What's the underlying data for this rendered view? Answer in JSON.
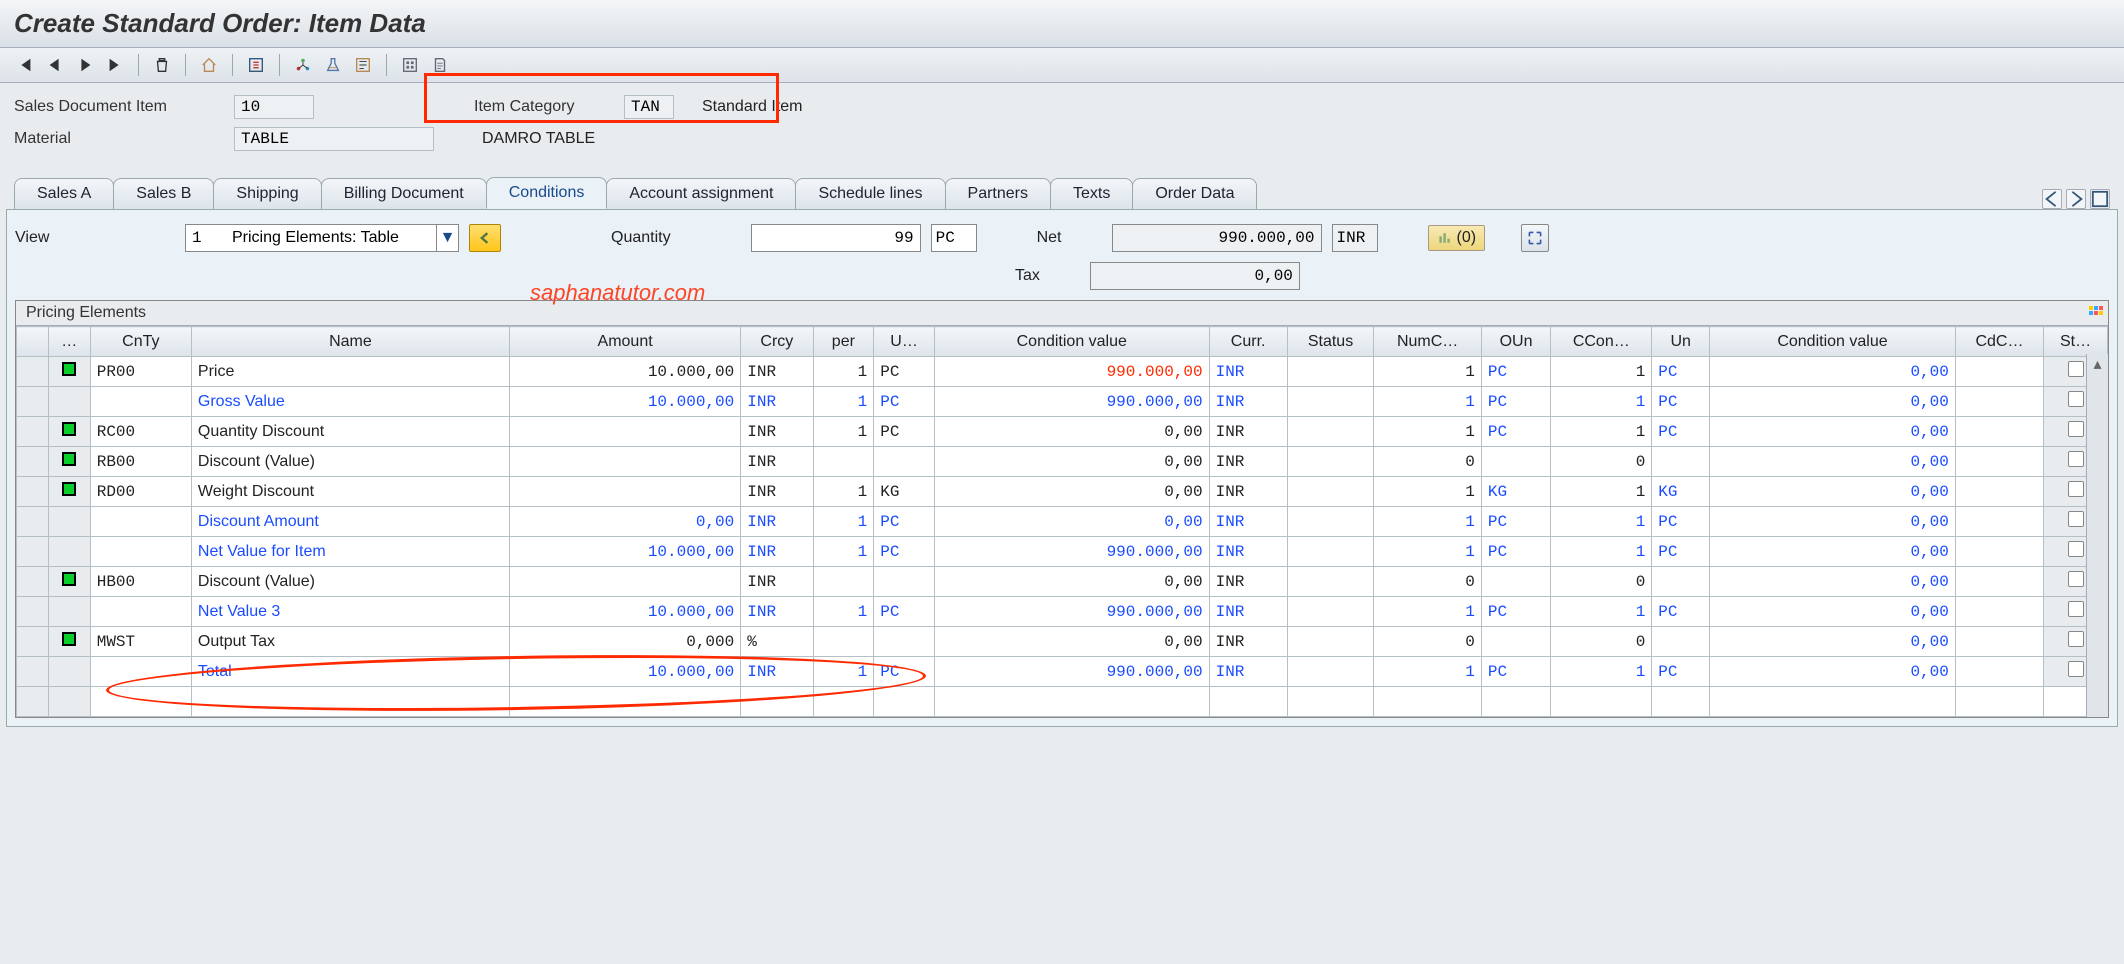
{
  "title": "Create Standard Order: Item Data",
  "watermark": "saphanatutor.com",
  "header": {
    "sales_doc_item_label": "Sales Document Item",
    "sales_doc_item_value": "10",
    "item_category_label": "Item Category",
    "item_category_value": "TAN",
    "item_category_text": "Standard Item",
    "material_label": "Material",
    "material_value": "TABLE",
    "material_text": "DAMRO TABLE"
  },
  "tabs": [
    "Sales A",
    "Sales B",
    "Shipping",
    "Billing Document",
    "Conditions",
    "Account assignment",
    "Schedule lines",
    "Partners",
    "Texts",
    "Order Data"
  ],
  "active_tab": "Conditions",
  "panel": {
    "view_label": "View",
    "view_num": "1",
    "view_text": "Pricing Elements: Table",
    "quantity_label": "Quantity",
    "quantity_value": "99",
    "quantity_unit": "PC",
    "net_label": "Net",
    "net_value": "990.000,00",
    "net_unit": "INR",
    "tax_label": "Tax",
    "tax_value": "0,00",
    "alloc_count": "(0)"
  },
  "grid": {
    "title": "Pricing Elements",
    "headers": [
      "…",
      "CnTy",
      "Name",
      "Amount",
      "Crcy",
      "per",
      "U…",
      "Condition value",
      "Curr.",
      "Status",
      "NumC…",
      "OUn",
      "CCon…",
      "Un",
      "Condition value",
      "CdC…",
      "St…"
    ],
    "rows": [
      {
        "status": true,
        "cnty": "PR00",
        "name": "Price",
        "amount": "10.000,00",
        "crcy": "INR",
        "per": "1",
        "u": "PC",
        "cv": "990.000,00",
        "curr": "INR",
        "numc": "1",
        "oun": "PC",
        "ccon": "1",
        "un": "PC",
        "cv2": "0,00",
        "blue": false,
        "cvred": true,
        "ounblue": true,
        "unblue": true
      },
      {
        "status": false,
        "cnty": "",
        "name": "Gross Value",
        "amount": "10.000,00",
        "crcy": "INR",
        "per": "1",
        "u": "PC",
        "cv": "990.000,00",
        "curr": "INR",
        "numc": "1",
        "oun": "PC",
        "ccon": "1",
        "un": "PC",
        "cv2": "0,00",
        "blue": true
      },
      {
        "status": true,
        "cnty": "RC00",
        "name": "Quantity Discount",
        "amount": "",
        "crcy": "INR",
        "per": "1",
        "u": "PC",
        "cv": "0,00",
        "curr": "INR",
        "numc": "1",
        "oun": "PC",
        "ccon": "1",
        "un": "PC",
        "cv2": "0,00",
        "blue": false,
        "ounblue": true,
        "unblue": true
      },
      {
        "status": true,
        "cnty": "RB00",
        "name": "Discount (Value)",
        "amount": "",
        "crcy": "INR",
        "per": "",
        "u": "",
        "cv": "0,00",
        "curr": "INR",
        "numc": "0",
        "oun": "",
        "ccon": "0",
        "un": "",
        "cv2": "0,00",
        "blue": false
      },
      {
        "status": true,
        "cnty": "RD00",
        "name": "Weight Discount",
        "amount": "",
        "crcy": "INR",
        "per": "1",
        "u": "KG",
        "cv": "0,00",
        "curr": "INR",
        "numc": "1",
        "oun": "KG",
        "ccon": "1",
        "un": "KG",
        "cv2": "0,00",
        "blue": false,
        "ounblue": true,
        "unblue": true
      },
      {
        "status": false,
        "cnty": "",
        "name": "Discount Amount",
        "amount": "0,00",
        "crcy": "INR",
        "per": "1",
        "u": "PC",
        "cv": "0,00",
        "curr": "INR",
        "numc": "1",
        "oun": "PC",
        "ccon": "1",
        "un": "PC",
        "cv2": "0,00",
        "blue": true
      },
      {
        "status": false,
        "cnty": "",
        "name": "Net Value for Item",
        "amount": "10.000,00",
        "crcy": "INR",
        "per": "1",
        "u": "PC",
        "cv": "990.000,00",
        "curr": "INR",
        "numc": "1",
        "oun": "PC",
        "ccon": "1",
        "un": "PC",
        "cv2": "0,00",
        "blue": true
      },
      {
        "status": true,
        "cnty": "HB00",
        "name": "Discount (Value)",
        "amount": "",
        "crcy": "INR",
        "per": "",
        "u": "",
        "cv": "0,00",
        "curr": "INR",
        "numc": "0",
        "oun": "",
        "ccon": "0",
        "un": "",
        "cv2": "0,00",
        "blue": false
      },
      {
        "status": false,
        "cnty": "",
        "name": "Net Value 3",
        "amount": "10.000,00",
        "crcy": "INR",
        "per": "1",
        "u": "PC",
        "cv": "990.000,00",
        "curr": "INR",
        "numc": "1",
        "oun": "PC",
        "ccon": "1",
        "un": "PC",
        "cv2": "0,00",
        "blue": true
      },
      {
        "status": true,
        "cnty": "MWST",
        "name": "Output Tax",
        "amount": "0,000",
        "crcy": "%",
        "per": "",
        "u": "",
        "cv": "0,00",
        "curr": "INR",
        "numc": "0",
        "oun": "",
        "ccon": "0",
        "un": "",
        "cv2": "0,00",
        "blue": false
      },
      {
        "status": false,
        "cnty": "",
        "name": "Total",
        "amount": "10.000,00",
        "crcy": "INR",
        "per": "1",
        "u": "PC",
        "cv": "990.000,00",
        "curr": "INR",
        "numc": "1",
        "oun": "PC",
        "ccon": "1",
        "un": "PC",
        "cv2": "0,00",
        "blue": true
      }
    ]
  }
}
